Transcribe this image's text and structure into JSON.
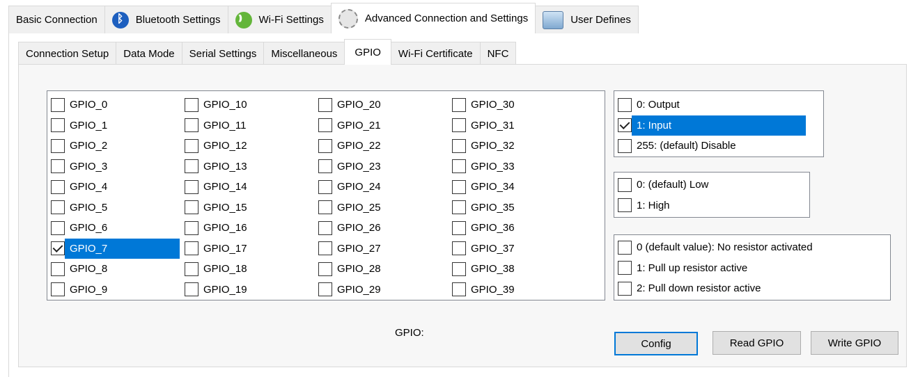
{
  "top_tabs": [
    {
      "label": "Basic Connection",
      "icon": ""
    },
    {
      "label": "Bluetooth Settings",
      "icon": "bluetooth-icon"
    },
    {
      "label": "Wi-Fi Settings",
      "icon": "wifi-icon"
    },
    {
      "label": "Advanced Connection and Settings",
      "icon": "gear-icon",
      "active": true
    },
    {
      "label": "User Defines",
      "icon": "user-defines-icon"
    }
  ],
  "sub_tabs": [
    {
      "label": "Connection Setup"
    },
    {
      "label": "Data Mode"
    },
    {
      "label": "Serial Settings"
    },
    {
      "label": "Miscellaneous"
    },
    {
      "label": "GPIO",
      "active": true
    },
    {
      "label": "Wi-Fi Certificate"
    },
    {
      "label": "NFC"
    }
  ],
  "gpio_list": [
    {
      "label": "GPIO_0",
      "checked": false
    },
    {
      "label": "GPIO_1",
      "checked": false
    },
    {
      "label": "GPIO_2",
      "checked": false
    },
    {
      "label": "GPIO_3",
      "checked": false
    },
    {
      "label": "GPIO_4",
      "checked": false
    },
    {
      "label": "GPIO_5",
      "checked": false
    },
    {
      "label": "GPIO_6",
      "checked": false
    },
    {
      "label": "GPIO_7",
      "checked": true,
      "selected": true
    },
    {
      "label": "GPIO_8",
      "checked": false
    },
    {
      "label": "GPIO_9",
      "checked": false
    },
    {
      "label": "GPIO_10",
      "checked": false
    },
    {
      "label": "GPIO_11",
      "checked": false
    },
    {
      "label": "GPIO_12",
      "checked": false
    },
    {
      "label": "GPIO_13",
      "checked": false
    },
    {
      "label": "GPIO_14",
      "checked": false
    },
    {
      "label": "GPIO_15",
      "checked": false
    },
    {
      "label": "GPIO_16",
      "checked": false
    },
    {
      "label": "GPIO_17",
      "checked": false
    },
    {
      "label": "GPIO_18",
      "checked": false
    },
    {
      "label": "GPIO_19",
      "checked": false
    },
    {
      "label": "GPIO_20",
      "checked": false
    },
    {
      "label": "GPIO_21",
      "checked": false
    },
    {
      "label": "GPIO_22",
      "checked": false
    },
    {
      "label": "GPIO_23",
      "checked": false
    },
    {
      "label": "GPIO_24",
      "checked": false
    },
    {
      "label": "GPIO_25",
      "checked": false
    },
    {
      "label": "GPIO_26",
      "checked": false
    },
    {
      "label": "GPIO_27",
      "checked": false
    },
    {
      "label": "GPIO_28",
      "checked": false
    },
    {
      "label": "GPIO_29",
      "checked": false
    },
    {
      "label": "GPIO_30",
      "checked": false
    },
    {
      "label": "GPIO_31",
      "checked": false
    },
    {
      "label": "GPIO_32",
      "checked": false
    },
    {
      "label": "GPIO_33",
      "checked": false
    },
    {
      "label": "GPIO_34",
      "checked": false
    },
    {
      "label": "GPIO_35",
      "checked": false
    },
    {
      "label": "GPIO_36",
      "checked": false
    },
    {
      "label": "GPIO_37",
      "checked": false
    },
    {
      "label": "GPIO_38",
      "checked": false
    },
    {
      "label": "GPIO_39",
      "checked": false
    }
  ],
  "mode_list": [
    {
      "label": "0: Output",
      "checked": false
    },
    {
      "label": "1: Input",
      "checked": true,
      "selected": true
    },
    {
      "label": "255: (default) Disable",
      "checked": false
    }
  ],
  "level_list": [
    {
      "label": "0: (default) Low",
      "checked": false
    },
    {
      "label": "1: High",
      "checked": false
    }
  ],
  "pull_list": [
    {
      "label": "0 (default value): No resistor activated",
      "checked": false
    },
    {
      "label": "1: Pull up resistor active",
      "checked": false
    },
    {
      "label": "2: Pull down resistor active",
      "checked": false
    }
  ],
  "gpio_caption": "GPIO:",
  "buttons": {
    "config": "Config",
    "read": "Read GPIO",
    "write": "Write GPIO"
  },
  "colors": {
    "selection": "#0078d7",
    "tab_bg": "#f0f0f0",
    "panel_bg": "#f7f7f7"
  }
}
